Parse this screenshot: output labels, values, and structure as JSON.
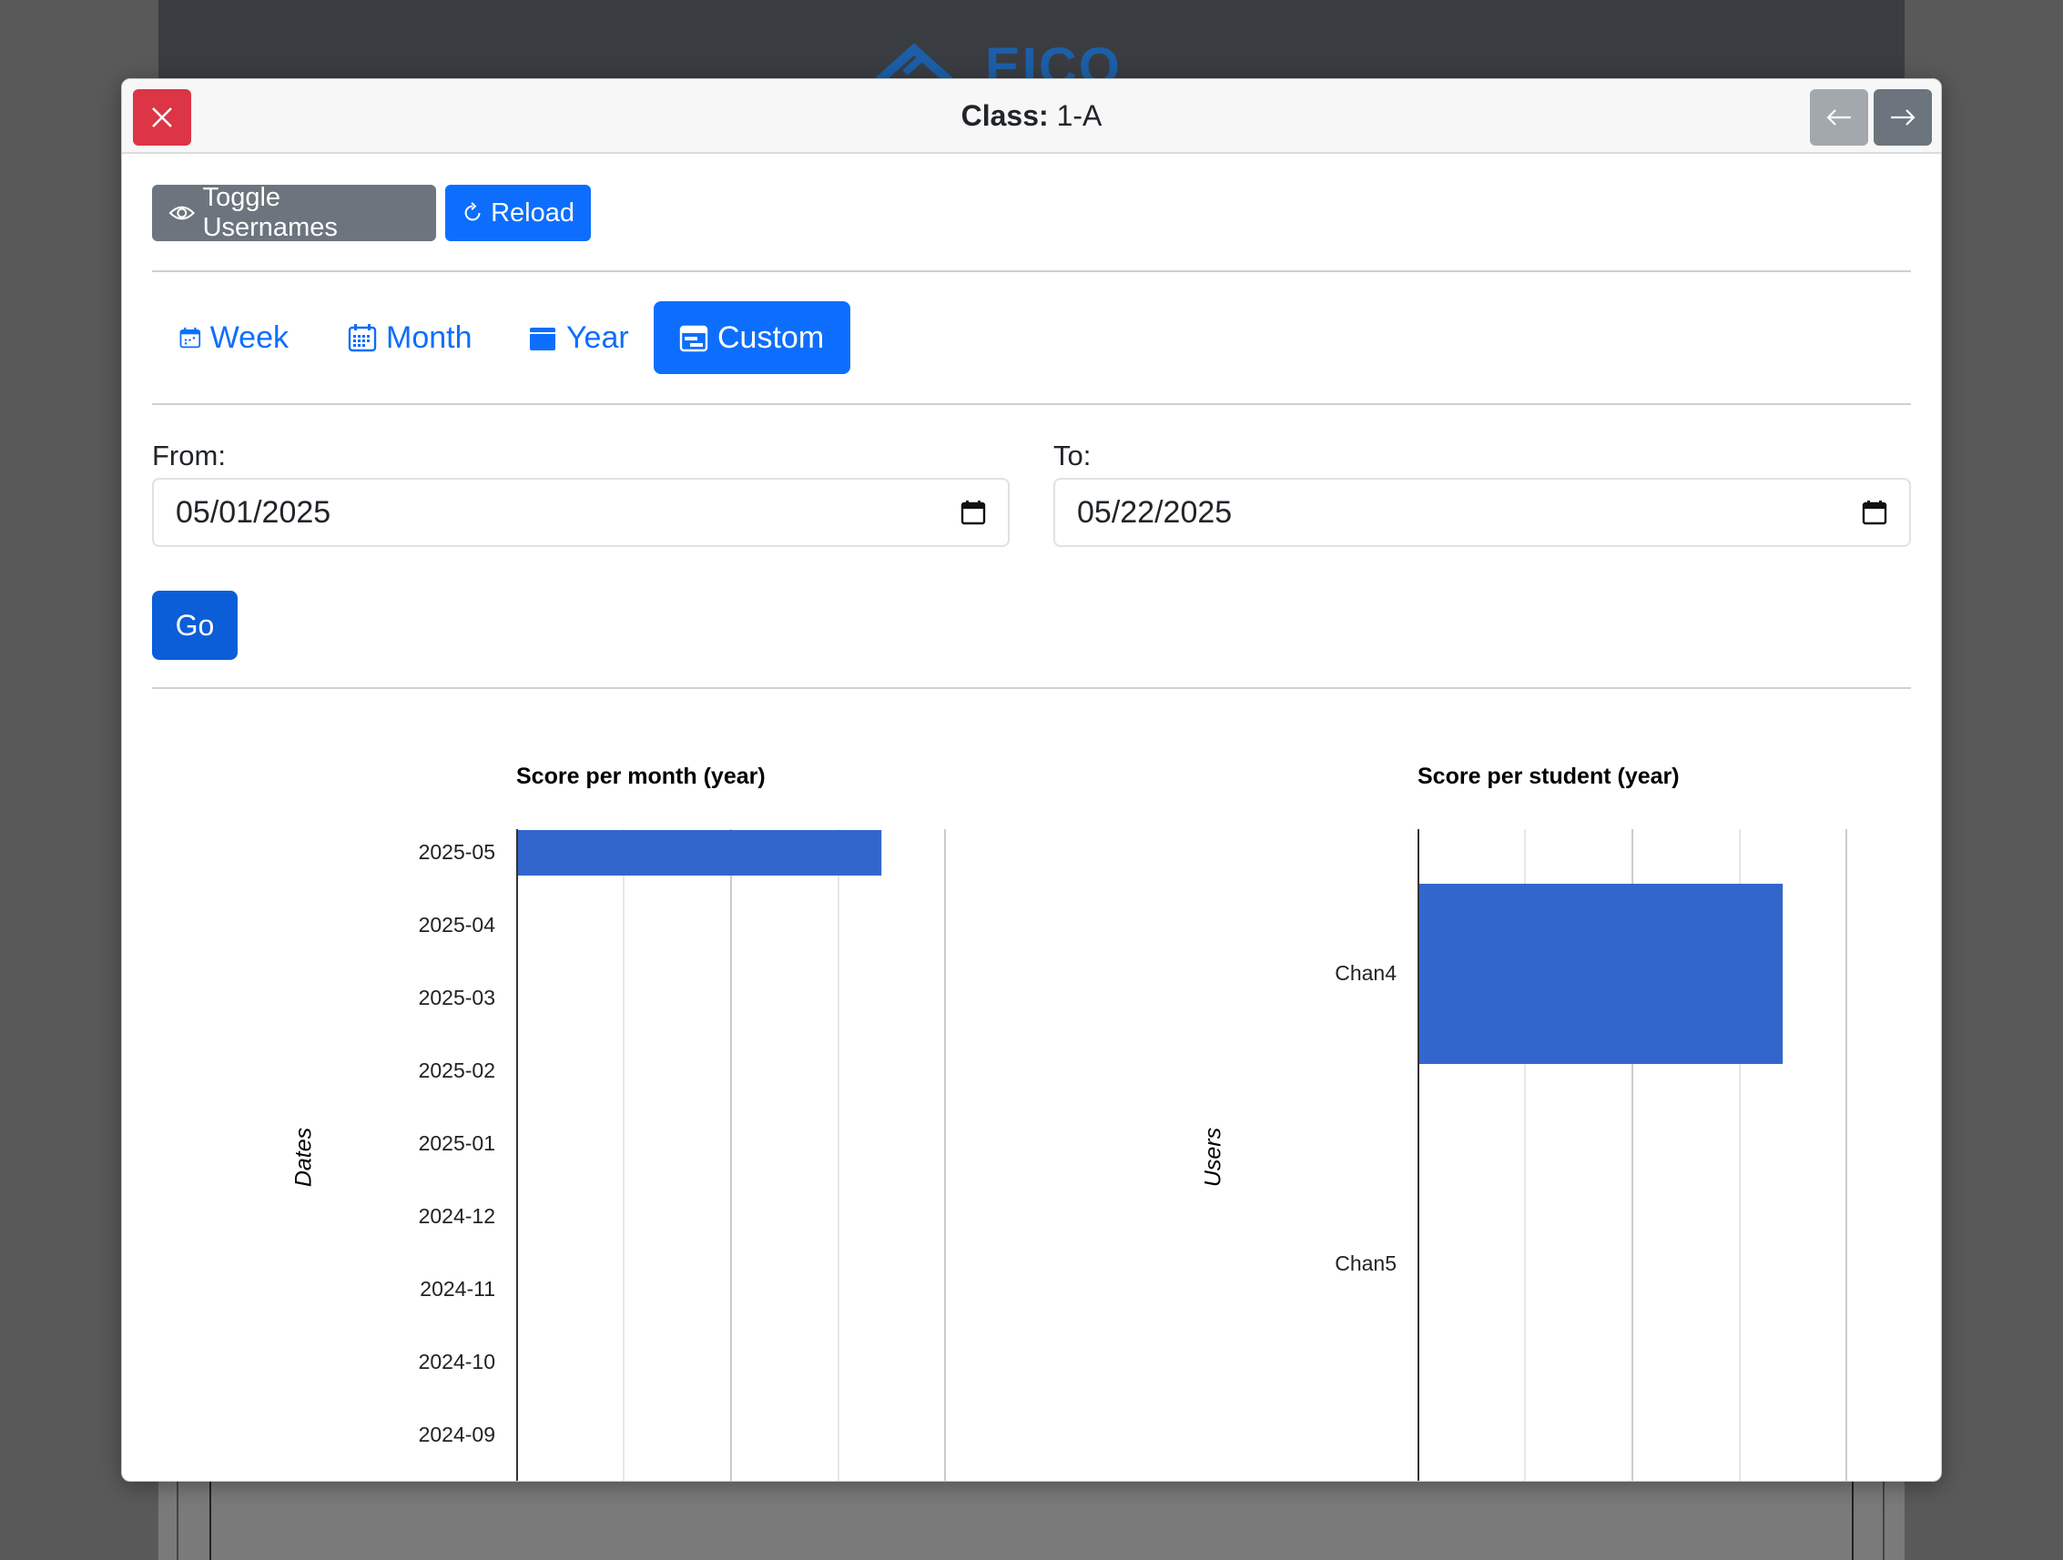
{
  "background": {
    "logo_text": "EICO"
  },
  "modal": {
    "title_label": "Class:",
    "title_value": "1-A",
    "close_icon": "x-icon",
    "prev_icon": "arrow-left-icon",
    "next_icon": "arrow-right-icon"
  },
  "toolbar": {
    "toggle_label": "Toggle Usernames",
    "reload_label": "Reload"
  },
  "range_tabs": [
    {
      "label": "Week",
      "icon": "calendar-week-icon",
      "active": false
    },
    {
      "label": "Month",
      "icon": "calendar-month-icon",
      "active": false
    },
    {
      "label": "Year",
      "icon": "calendar-year-icon",
      "active": false
    },
    {
      "label": "Custom",
      "icon": "calendar-range-icon",
      "active": true
    }
  ],
  "date_range": {
    "from_label": "From:",
    "from_value": "05/01/2025",
    "to_label": "To:",
    "to_value": "05/22/2025",
    "go_label": "Go"
  },
  "colors": {
    "primary": "#0d6efd",
    "secondary": "#6c757d",
    "danger": "#dc3545",
    "bar": "#3366cc"
  },
  "chart_data": [
    {
      "type": "bar",
      "orientation": "horizontal",
      "title": "Score per month (year)",
      "ylabel": "Dates",
      "categories": [
        "2025-05",
        "2025-04",
        "2025-03",
        "2025-02",
        "2025-01",
        "2024-12",
        "2024-11",
        "2024-10",
        "2024-09"
      ],
      "values": [
        3.4,
        0,
        0,
        0,
        0,
        0,
        0,
        0,
        0
      ],
      "xlim": [
        0,
        4
      ],
      "grid": true
    },
    {
      "type": "bar",
      "orientation": "horizontal",
      "title": "Score per student (year)",
      "ylabel": "Users",
      "categories": [
        "Chan4",
        "Chan5"
      ],
      "values": [
        3.4,
        0
      ],
      "xlim": [
        0,
        4
      ],
      "grid": true
    }
  ]
}
